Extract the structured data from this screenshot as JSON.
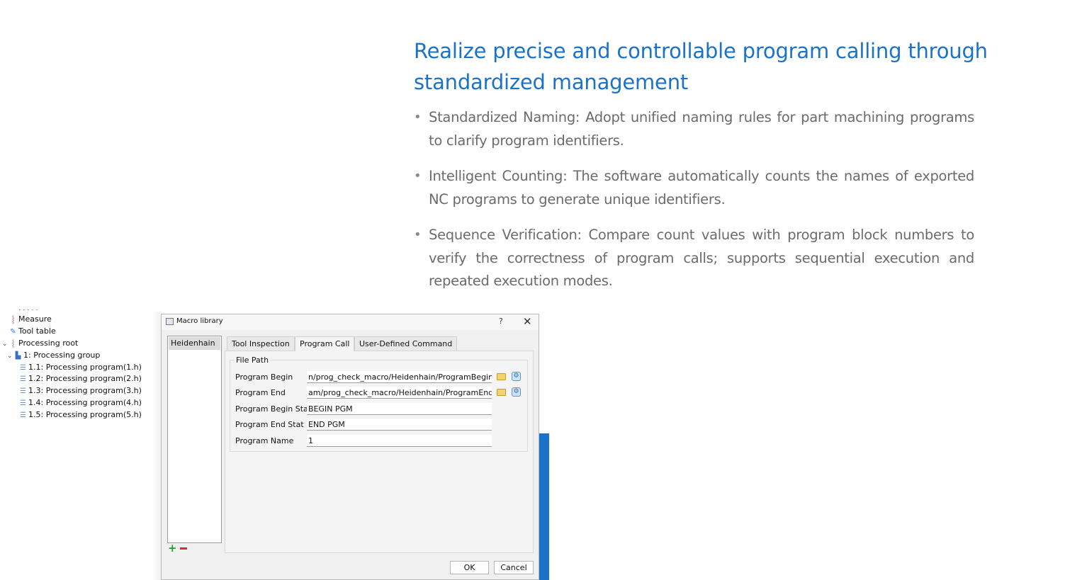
{
  "marketing": {
    "headline": "Realize precise and controllable program calling through standardized management",
    "bullets": [
      "Standardized Naming: Adopt unified naming rules for part machining programs to clarify program identifiers.",
      "Intelligent Counting: The software automatically counts the names of exported NC programs to generate unique identifiers.",
      "Sequence Verification: Compare count values with program block numbers to verify the correctness of program calls; supports sequential execution and repeated execution modes."
    ],
    "bullet_glyph": "•",
    "accent_color": "#1a73c9"
  },
  "tree": {
    "clipped_top": "· · · · ·",
    "items": [
      {
        "label": "Measure",
        "icon": "measure-icon"
      },
      {
        "label": "Tool table",
        "icon": "pin-icon"
      },
      {
        "label": "Processing root",
        "icon": "root-icon"
      },
      {
        "label": "1: Processing group",
        "icon": "group-icon"
      },
      {
        "label": "1.1: Processing program(1.h)",
        "icon": "program-icon"
      },
      {
        "label": "1.2: Processing program(2.h)",
        "icon": "program-icon"
      },
      {
        "label": "1.3: Processing program(3.h)",
        "icon": "program-icon"
      },
      {
        "label": "1.4: Processing program(4.h)",
        "icon": "program-icon"
      },
      {
        "label": "1.5: Processing program(5.h)",
        "icon": "program-icon"
      }
    ],
    "chevron": "⌄"
  },
  "dialog": {
    "title": "Macro library",
    "help": "?",
    "close": "✕",
    "library_items": [
      "Heidenhain"
    ],
    "add": "+",
    "tabs": [
      "Tool Inspection",
      "Program Call",
      "User-Defined Command"
    ],
    "active_tab": "Program Call",
    "group_title": "File Path",
    "fields": [
      {
        "label": "Program Begin",
        "value": "n/prog_check_macro/Heidenhain/ProgramBegin.txt"
      },
      {
        "label": "Program End",
        "value": "am/prog_check_macro/Heidenhain/ProgramEnd.txt"
      },
      {
        "label": "Program Begin Stat",
        "value": "BEGIN PGM"
      },
      {
        "label": "Program End Stat",
        "value": "END PGM"
      },
      {
        "label": "Program Name",
        "value": "1"
      }
    ],
    "gear_glyph": "⚙",
    "ok": "OK",
    "cancel": "Cancel"
  }
}
